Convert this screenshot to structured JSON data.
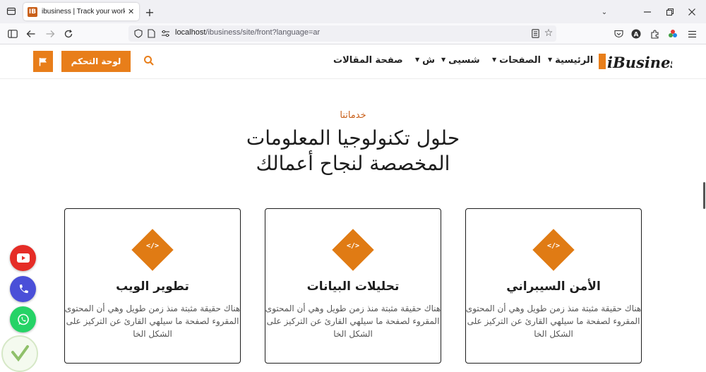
{
  "browser": {
    "tab_title": "ibusiness | Track your work with",
    "tab_favicon": "IB",
    "url_host": "localhost",
    "url_path": "/ibusiness/site/front?language=ar"
  },
  "header": {
    "dashboard_label": "لوحة التحكم",
    "menu": {
      "home": "الرئيسية",
      "pages": "الصفحات",
      "shasi": "شسيى",
      "sh": "ش",
      "articles": "صفحة المقالات"
    },
    "logo_text": "iBusiness"
  },
  "hero": {
    "eyebrow": "خدماتنا",
    "headline": "حلول تكنولوجيا المعلومات المخصصة لنجاح أعمالك"
  },
  "cards": [
    {
      "title": "الأمن السيبراني",
      "body": "هناك حقيقة مثبتة منذ زمن طويل وهي أن المحتوى المقروء لصفحة ما سيلهي القارئ عن التركيز على الشكل الخا",
      "icon": "</>"
    },
    {
      "title": "تحليلات البيانات",
      "body": "هناك حقيقة مثبتة منذ زمن طويل وهي أن المحتوى المقروء لصفحة ما سيلهي القارئ عن التركيز على الشكل الخا",
      "icon": "</>"
    },
    {
      "title": "تطوير الويب",
      "body": "هناك حقيقة مثبتة منذ زمن طويل وهي أن المحتوى المقروء لصفحة ما سيلهي القارئ عن التركيز على الشكل الخا",
      "icon": "</>"
    }
  ],
  "colors": {
    "accent": "#e87e1a",
    "youtube": "#e52d27",
    "phone": "#4a4fd8",
    "whatsapp": "#25d366"
  }
}
